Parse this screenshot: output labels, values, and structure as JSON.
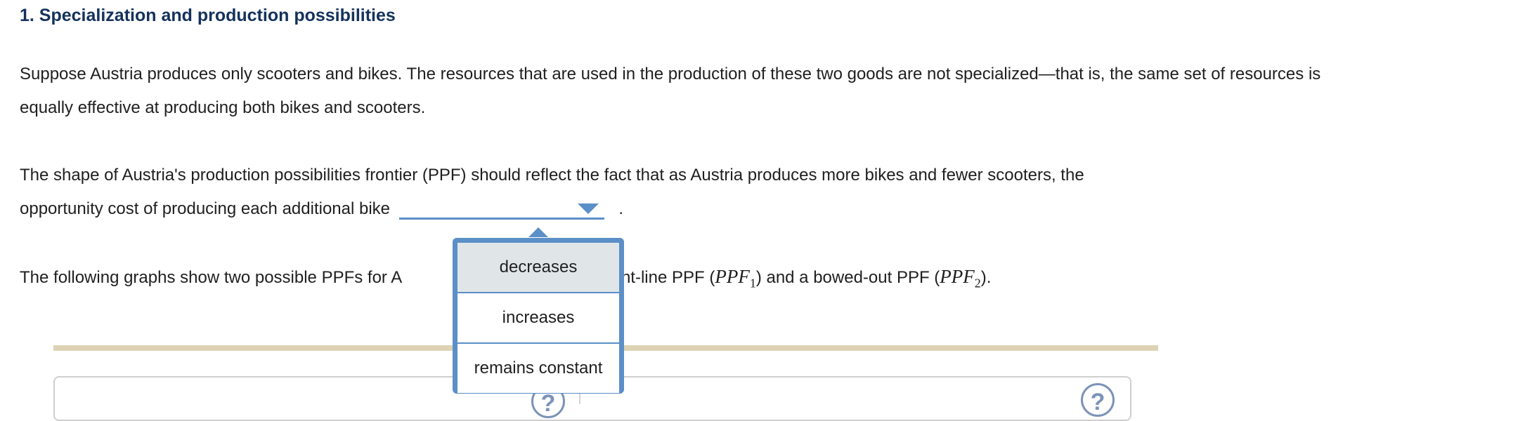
{
  "heading": "1. Specialization and production possibilities",
  "paragraph1": "Suppose Austria produces only scooters and bikes. The resources that are used in the production of these two goods are not specialized—that is, the same set of resources is equally effective at producing both bikes and scooters.",
  "paragraph2_line1": "The shape of Austria's production possibilities frontier (PPF) should reflect the fact that as Austria produces more bikes and fewer scooters, the",
  "paragraph2_line2": "opportunity cost of producing each additional bike",
  "paragraph2_end": ".",
  "paragraph3_start": "The following graphs show two possible PPFs for A",
  "paragraph3_mid": "straight-line PPF (",
  "ppf1_base": "PPF",
  "ppf1_sub": "1",
  "paragraph3_mid2": ") and a bowed-out PPF (",
  "ppf2_base": "PPF",
  "ppf2_sub": "2",
  "paragraph3_end": ").",
  "dropdown": {
    "selected": "",
    "options": [
      "decreases",
      "increases",
      "remains constant"
    ],
    "hovered_index": 0
  },
  "help_icon_glyph": "?",
  "colors": {
    "heading": "#14325c",
    "accent": "#5b8fc7",
    "rule": "#ddd3b4",
    "hover": "#e0e6e8"
  }
}
